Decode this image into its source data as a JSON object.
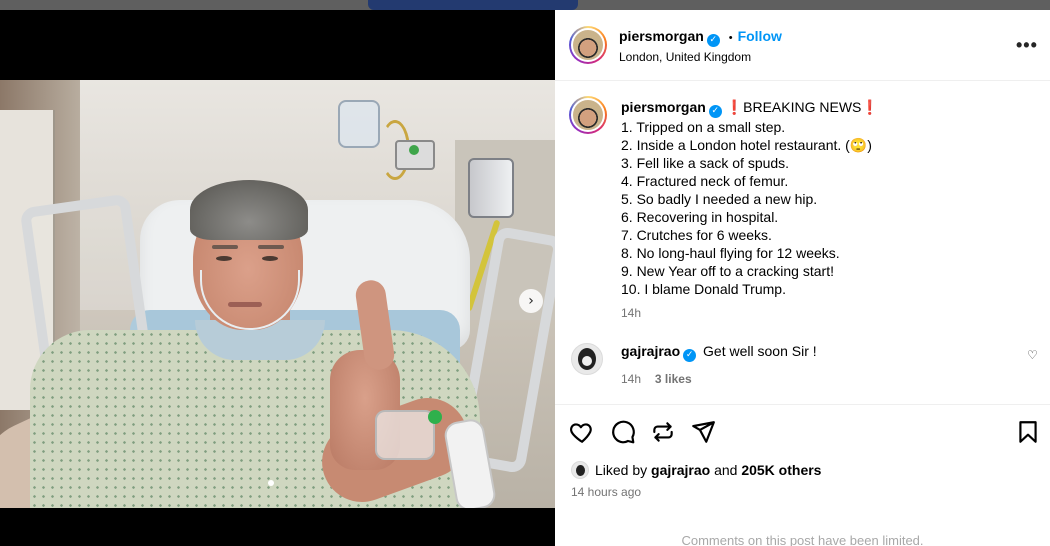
{
  "post": {
    "author": {
      "username": "piersmorgan",
      "location": "London, United Kingdom",
      "follow_label": "Follow",
      "separator": "•"
    },
    "more_label": "•••",
    "caption": {
      "username": "piersmorgan",
      "title": "BREAKING NEWS",
      "lines": [
        "1. Tripped on a small step.",
        "2. Inside a London hotel restaurant. (🙄)",
        "3. Fell like a sack of spuds.",
        "4. Fractured neck of femur.",
        "5. So badly I needed a new hip.",
        "6. Recovering in hospital.",
        "7. Crutches for 6 weeks.",
        "8. No long-haul flying for 12 weeks.",
        "9. New Year off to a cracking start!",
        "10. I blame Donald Trump."
      ],
      "time": "14h"
    },
    "comments": [
      {
        "username": "gajrajrao",
        "text": "Get well soon Sir !",
        "time": "14h",
        "likes": "3 likes"
      }
    ],
    "likes": {
      "prefix": "Liked by",
      "user": "gajrajrao",
      "and": "and",
      "others": "205K others"
    },
    "timestamp": "14 hours ago",
    "comments_notice": "Comments on this post have been limited."
  },
  "icons": {
    "verified": "✓",
    "exclamation": "❗",
    "next": "›",
    "comment_heart": "♡"
  },
  "colors": {
    "accent": "#0095f6",
    "muted": "#737373",
    "flag": "#e0182c"
  }
}
